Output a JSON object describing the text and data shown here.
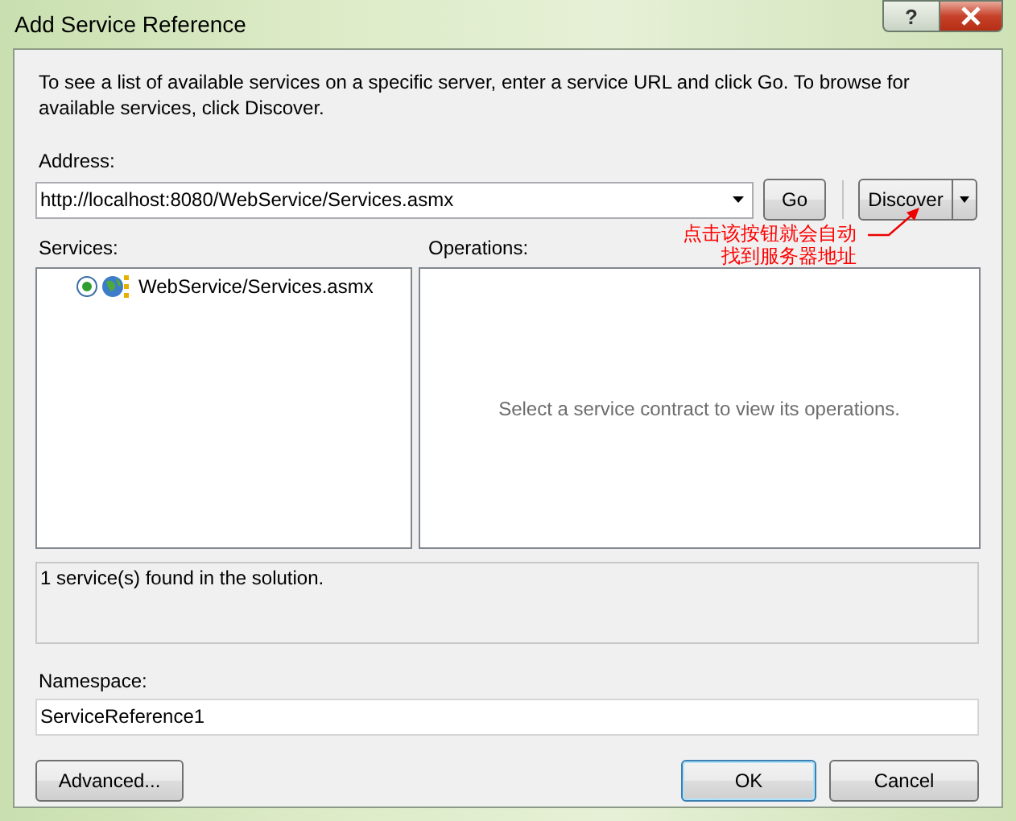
{
  "window": {
    "title": "Add Service Reference",
    "help_button": "?"
  },
  "description": "To see a list of available services on a specific server, enter a service URL and click Go. To browse for available services, click Discover.",
  "address": {
    "label": "Address:",
    "value": "http://localhost:8080/WebService/Services.asmx"
  },
  "go_button": "Go",
  "discover_button": "Discover",
  "annotation": {
    "lines": [
      "点击该按钮就会自动",
      "找到服务器地址"
    ]
  },
  "services": {
    "label": "Services:",
    "items": [
      {
        "name": "WebService/Services.asmx",
        "selected": true
      }
    ]
  },
  "operations": {
    "label": "Operations:",
    "message": "Select a service contract to view its operations."
  },
  "status": "1 service(s) found in the solution.",
  "namespace": {
    "label": "Namespace:",
    "value": "ServiceReference1"
  },
  "buttons": [
    {
      "label": "Advanced...",
      "default": false
    },
    {
      "label": "OK",
      "default": true
    },
    {
      "label": "Cancel",
      "default": false
    }
  ]
}
